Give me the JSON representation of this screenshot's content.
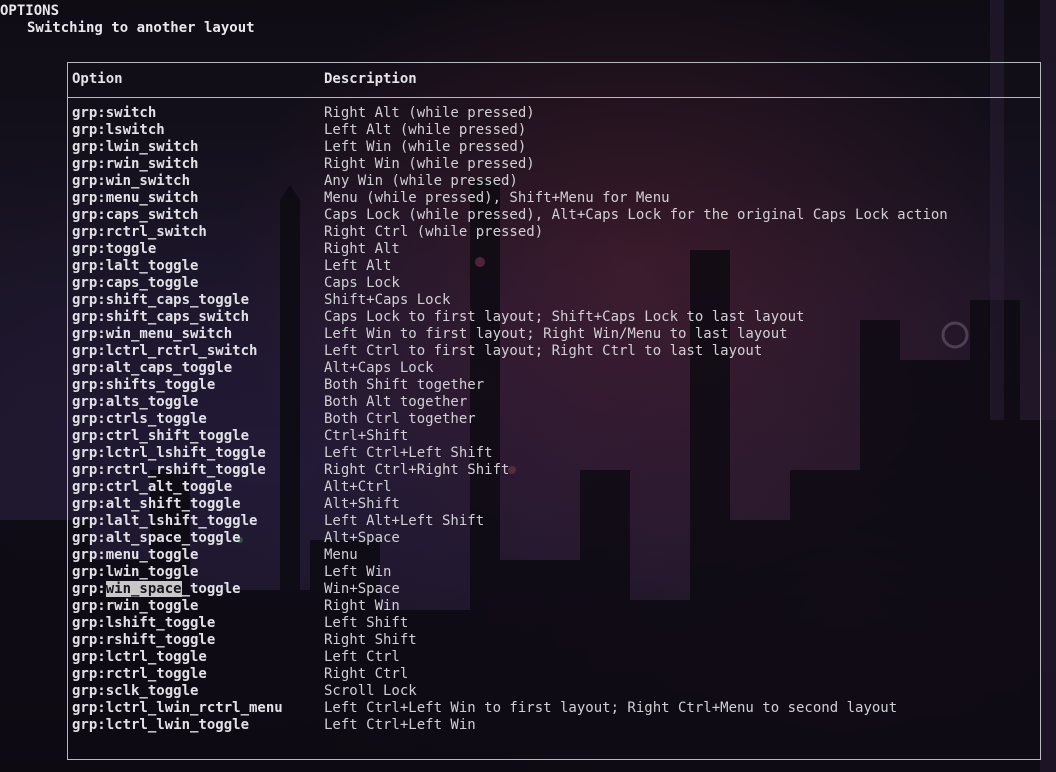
{
  "page": {
    "section_title": "OPTIONS",
    "subsection_title": "Switching to another layout"
  },
  "table": {
    "headers": {
      "option": "Option",
      "description": "Description"
    },
    "rows": [
      {
        "option": "grp:switch",
        "description": "Right Alt (while pressed)"
      },
      {
        "option": "grp:lswitch",
        "description": "Left Alt (while pressed)"
      },
      {
        "option": "grp:lwin_switch",
        "description": "Left Win (while pressed)"
      },
      {
        "option": "grp:rwin_switch",
        "description": "Right Win (while pressed)"
      },
      {
        "option": "grp:win_switch",
        "description": "Any Win (while pressed)"
      },
      {
        "option": "grp:menu_switch",
        "description": "Menu (while pressed), Shift+Menu for Menu"
      },
      {
        "option": "grp:caps_switch",
        "description": "Caps Lock (while pressed), Alt+Caps Lock for the original Caps Lock action"
      },
      {
        "option": "grp:rctrl_switch",
        "description": "Right Ctrl (while pressed)"
      },
      {
        "option": "grp:toggle",
        "description": "Right Alt"
      },
      {
        "option": "grp:lalt_toggle",
        "description": "Left Alt"
      },
      {
        "option": "grp:caps_toggle",
        "description": "Caps Lock"
      },
      {
        "option": "grp:shift_caps_toggle",
        "description": "Shift+Caps Lock"
      },
      {
        "option": "grp:shift_caps_switch",
        "description": "Caps Lock to first layout; Shift+Caps Lock to last layout"
      },
      {
        "option": "grp:win_menu_switch",
        "description": "Left Win to first layout; Right Win/Menu to last layout"
      },
      {
        "option": "grp:lctrl_rctrl_switch",
        "description": "Left Ctrl to first layout; Right Ctrl to last layout"
      },
      {
        "option": "grp:alt_caps_toggle",
        "description": "Alt+Caps Lock"
      },
      {
        "option": "grp:shifts_toggle",
        "description": "Both Shift together"
      },
      {
        "option": "grp:alts_toggle",
        "description": "Both Alt together"
      },
      {
        "option": "grp:ctrls_toggle",
        "description": "Both Ctrl together"
      },
      {
        "option": "grp:ctrl_shift_toggle",
        "description": "Ctrl+Shift"
      },
      {
        "option": "grp:lctrl_lshift_toggle",
        "description": "Left Ctrl+Left Shift"
      },
      {
        "option": "grp:rctrl_rshift_toggle",
        "description": "Right Ctrl+Right Shift"
      },
      {
        "option": "grp:ctrl_alt_toggle",
        "description": "Alt+Ctrl"
      },
      {
        "option": "grp:alt_shift_toggle",
        "description": "Alt+Shift"
      },
      {
        "option": "grp:lalt_lshift_toggle",
        "description": "Left Alt+Left Shift"
      },
      {
        "option": "grp:alt_space_toggle",
        "description": "Alt+Space"
      },
      {
        "option": "grp:menu_toggle",
        "description": "Menu"
      },
      {
        "option": "grp:lwin_toggle",
        "description": "Left Win"
      },
      {
        "option": "grp:win_space_toggle",
        "description": "Win+Space",
        "highlight": {
          "prefix": "grp:",
          "selected": "win_space",
          "suffix": "_toggle"
        }
      },
      {
        "option": "grp:rwin_toggle",
        "description": "Right Win"
      },
      {
        "option": "grp:lshift_toggle",
        "description": "Left Shift"
      },
      {
        "option": "grp:rshift_toggle",
        "description": "Right Shift"
      },
      {
        "option": "grp:lctrl_toggle",
        "description": "Left Ctrl"
      },
      {
        "option": "grp:rctrl_toggle",
        "description": "Right Ctrl"
      },
      {
        "option": "grp:sclk_toggle",
        "description": "Scroll Lock"
      },
      {
        "option": "grp:lctrl_lwin_rctrl_menu",
        "description": "Left Ctrl+Left Win to first layout; Right Ctrl+Menu to second layout"
      },
      {
        "option": "grp:lctrl_lwin_toggle",
        "description": "Left Ctrl+Left Win"
      }
    ]
  },
  "colors": {
    "text": "#d4d4d8",
    "border": "#b8b8c0",
    "selection_bg": "#c8c8c8"
  }
}
